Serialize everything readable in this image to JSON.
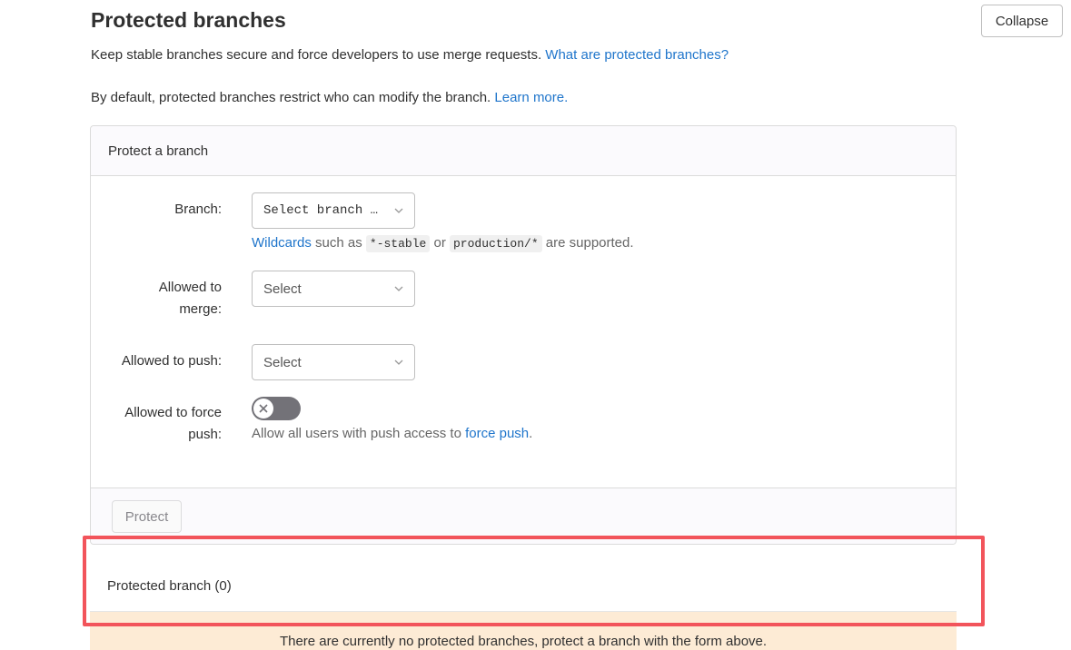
{
  "page": {
    "title": "Protected branches",
    "collapse_label": "Collapse",
    "intro_text": "Keep stable branches secure and force developers to use merge requests. ",
    "intro_link": "What are protected branches?",
    "default_text": "By default, protected branches restrict who can modify the branch. ",
    "default_link": "Learn more."
  },
  "form": {
    "header": "Protect a branch",
    "branch_label": "Branch:",
    "branch_value": "Select branch …",
    "wildcards_link": "Wildcards",
    "wildcards_text_1": " such as ",
    "wildcard_example_1": "*-stable",
    "wildcards_text_2": " or ",
    "wildcard_example_2": "production/*",
    "wildcards_text_3": " are supported.",
    "merge_label": "Allowed to merge:",
    "merge_value": "Select",
    "push_label": "Allowed to push:",
    "push_value": "Select",
    "force_push_label": "Allowed to force push:",
    "force_push_enabled": false,
    "force_push_help": "Allow all users with push access to ",
    "force_push_link": "force push",
    "force_push_help_end": ".",
    "protect_label": "Protect"
  },
  "protected_list": {
    "title": "Protected branch (0)",
    "empty_message": "There are currently no protected branches, protect a branch with the form above."
  },
  "colors": {
    "link": "#1f75cb",
    "highlight": "#f2545b",
    "empty_bar": "#fdebd5"
  },
  "icons": [
    "chevron-down-icon",
    "close-icon"
  ]
}
